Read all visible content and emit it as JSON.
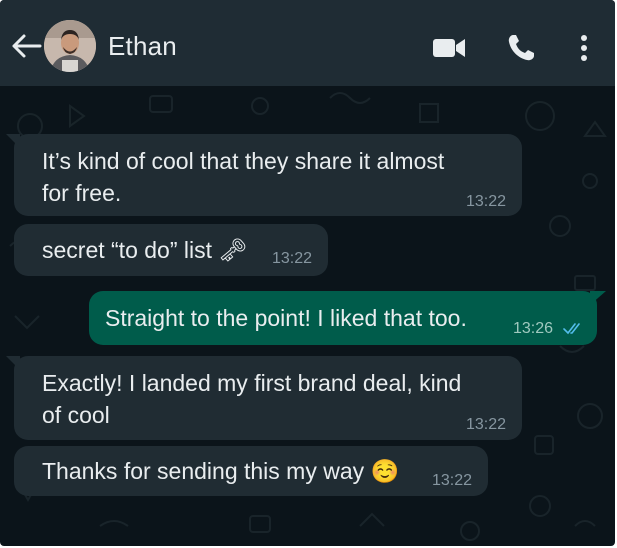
{
  "header": {
    "contact_name": "Ethan",
    "icons": [
      "back-arrow-icon",
      "video-call-icon",
      "phone-call-icon",
      "more-options-icon"
    ]
  },
  "messages": [
    {
      "direction": "incoming",
      "lines": [
        "It’s kind of cool that they share it almost",
        "for free."
      ],
      "time": "13:22"
    },
    {
      "direction": "incoming",
      "lines": [
        "secret “to do” list 🗝"
      ],
      "time": "13:22"
    },
    {
      "direction": "outgoing",
      "lines": [
        "Straight to the point! I liked that too."
      ],
      "time": "13:26",
      "status": "read"
    },
    {
      "direction": "incoming",
      "lines": [
        "Exactly! I landed my first brand deal, kind",
        "of cool"
      ],
      "time": "13:22"
    },
    {
      "direction": "incoming",
      "lines": [
        "Thanks for sending this my way ☺️"
      ],
      "time": "13:22"
    }
  ],
  "colors": {
    "chat_background": "#0b141a",
    "header_background": "#1f2c34",
    "incoming_bubble": "#202c33",
    "outgoing_bubble": "#005c4b",
    "read_receipt": "#53bdeb"
  }
}
